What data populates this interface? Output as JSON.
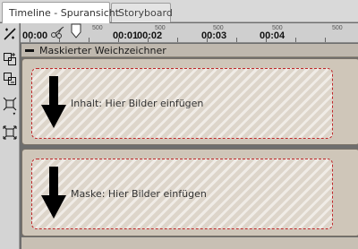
{
  "tabs": [
    {
      "label": "Timeline - Spuransicht",
      "active": true
    },
    {
      "label": "Storyboard",
      "active": false
    }
  ],
  "toolbar": {
    "tools": [
      {
        "icon": "magic-cut-icon",
        "glyph": "✂"
      },
      {
        "icon": "group-objects-icon",
        "glyph": "⧉"
      },
      {
        "icon": "ungroup-objects-icon",
        "glyph": "⧈"
      },
      {
        "icon": "fit-to-frame-icon",
        "glyph": "⌗"
      },
      {
        "icon": "expand-frame-icon",
        "glyph": "⤢"
      }
    ]
  },
  "ruler": {
    "major_labels": [
      "00:00",
      "00:01",
      "00:02",
      "00:03",
      "00:04"
    ],
    "minor_labels": [
      "500",
      "500",
      "500",
      "500",
      "500"
    ]
  },
  "group": {
    "title": "Maskierter Weichzeichner"
  },
  "tracks": [
    {
      "drop_text": "Inhalt: Hier Bilder einfügen"
    },
    {
      "drop_text": "Maske: Hier Bilder einfügen"
    }
  ],
  "colors": {
    "dropzone_border": "#c0282a",
    "track_fill": "#cfc6b9",
    "group_header": "#bfb8ae"
  }
}
